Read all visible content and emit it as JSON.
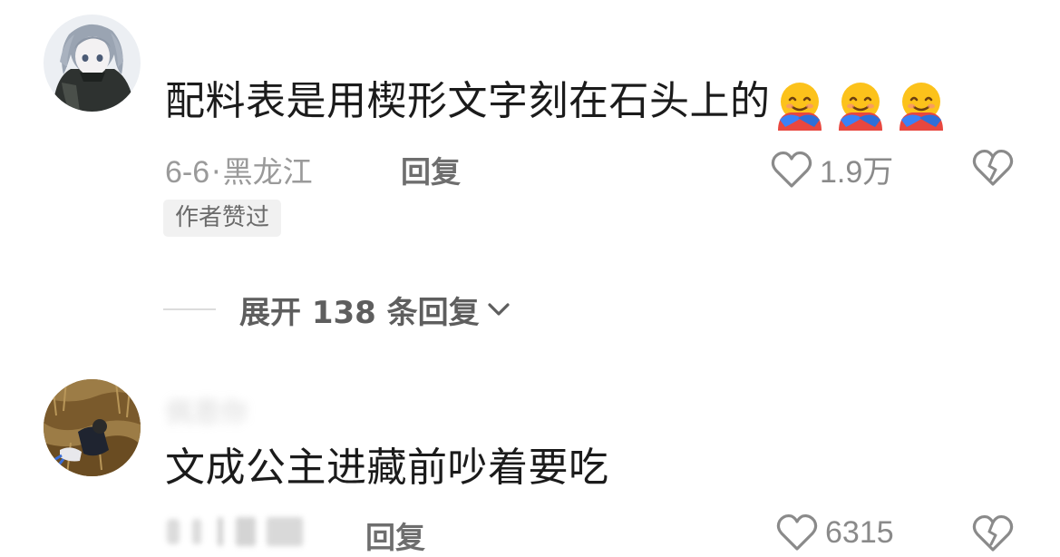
{
  "comments": [
    {
      "username": "　　　",
      "text": "配料表是用楔形文字刻在石头上的",
      "emojis": [
        "hugging-face-emoji",
        "hugging-face-emoji",
        "hugging-face-emoji"
      ],
      "date": "6-6",
      "separator": "·",
      "location": "黑龙江",
      "reply_label": "回复",
      "like_count": "1.9万",
      "badge": "作者赞过",
      "expand_label": "展开 138 条回复",
      "like_icon": "heart-outline-icon",
      "dislike_icon": "broken-heart-icon"
    },
    {
      "username": "佩恩你",
      "text": "文成公主进藏前吵着要吃",
      "meta_blurred": "",
      "reply_label": "回复",
      "like_count": "6315",
      "like_icon": "heart-outline-icon",
      "dislike_icon": "broken-heart-icon"
    }
  ],
  "colors": {
    "background": "#ffffff",
    "text_primary": "#1b1b1b",
    "text_secondary": "#9a9a9a",
    "badge_bg": "#f1f1f1"
  }
}
